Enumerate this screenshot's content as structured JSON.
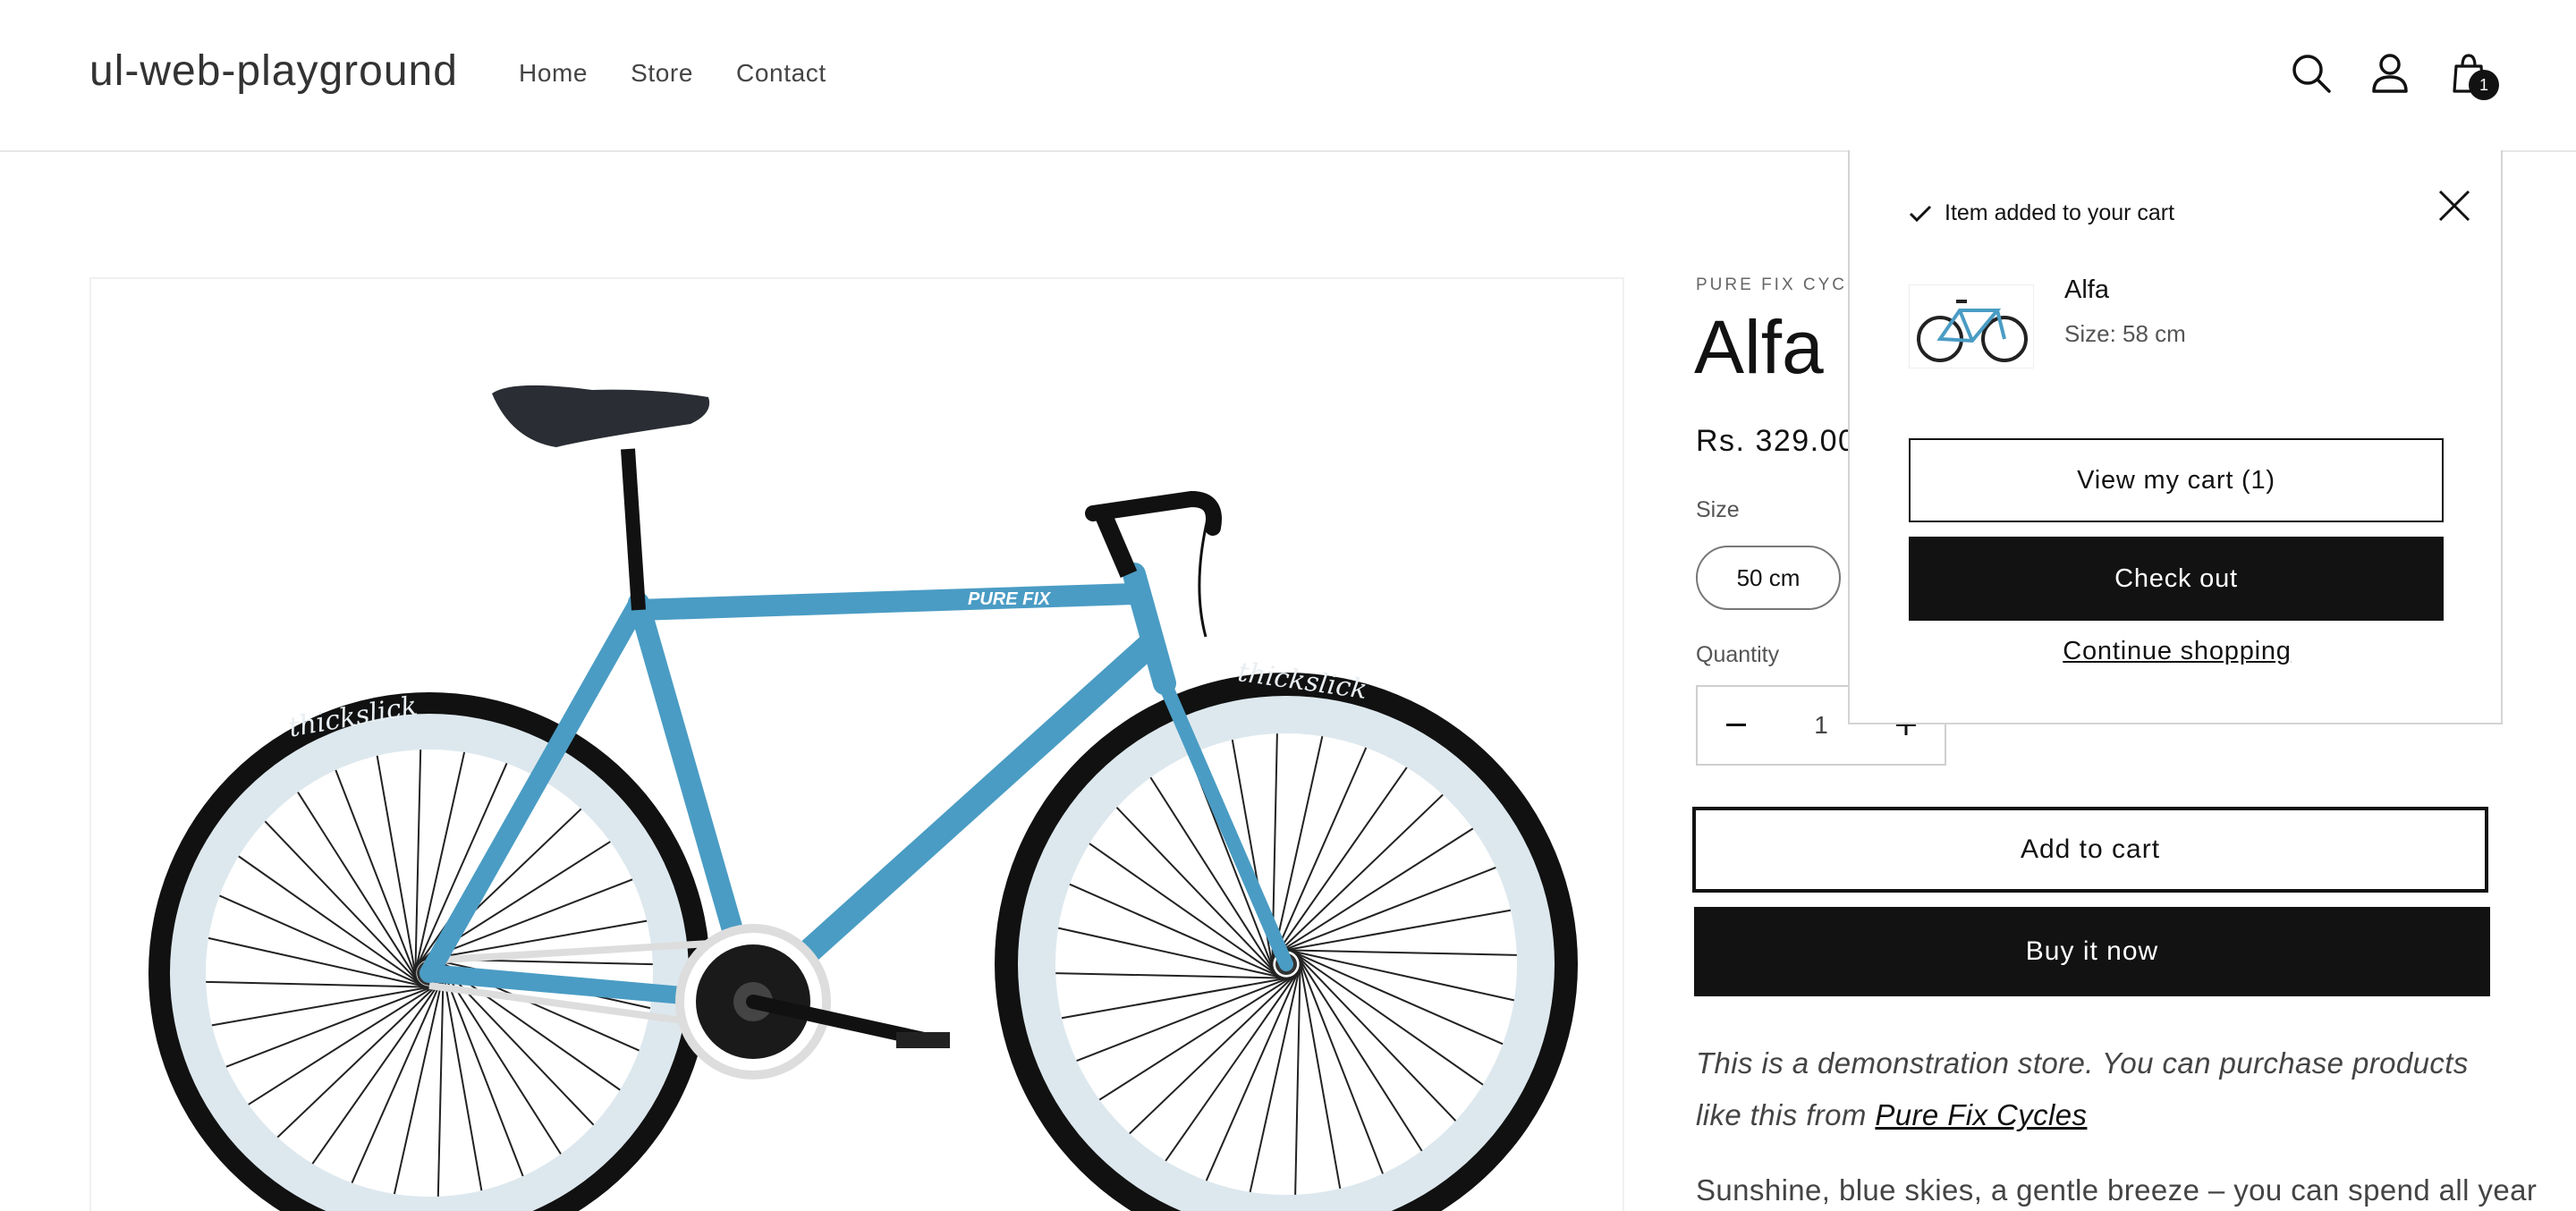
{
  "header": {
    "logo": "ul-web-playground",
    "nav": [
      "Home",
      "Store",
      "Contact"
    ],
    "cart_count": "1"
  },
  "product": {
    "vendor": "PURE FIX CYCLE.",
    "title": "Alfa",
    "price": "Rs. 329.00",
    "size_label": "Size",
    "size_option": "50 cm",
    "quantity_label": "Quantity",
    "quantity_value": "1",
    "add_to_cart": "Add to cart",
    "buy_now": "Buy it now",
    "description_prefix": "This is a demonstration store. You can purchase products like this from ",
    "description_link": "Pure Fix Cycles",
    "description2": "Sunshine, blue skies, a gentle breeze – you can spend all year"
  },
  "bike_brand": {
    "frame_text": "PURE FIX",
    "tire_text": "thickslick"
  },
  "cart_notification": {
    "heading": "Item added to your cart",
    "item_name": "Alfa",
    "item_size": "Size: 58 cm",
    "view_cart": "View my cart (1)",
    "checkout": "Check out",
    "continue": "Continue shopping"
  },
  "colors": {
    "frame": "#4a9cc4",
    "tire": "#111111",
    "rim": "#dde8ee",
    "accent": "#121212"
  }
}
